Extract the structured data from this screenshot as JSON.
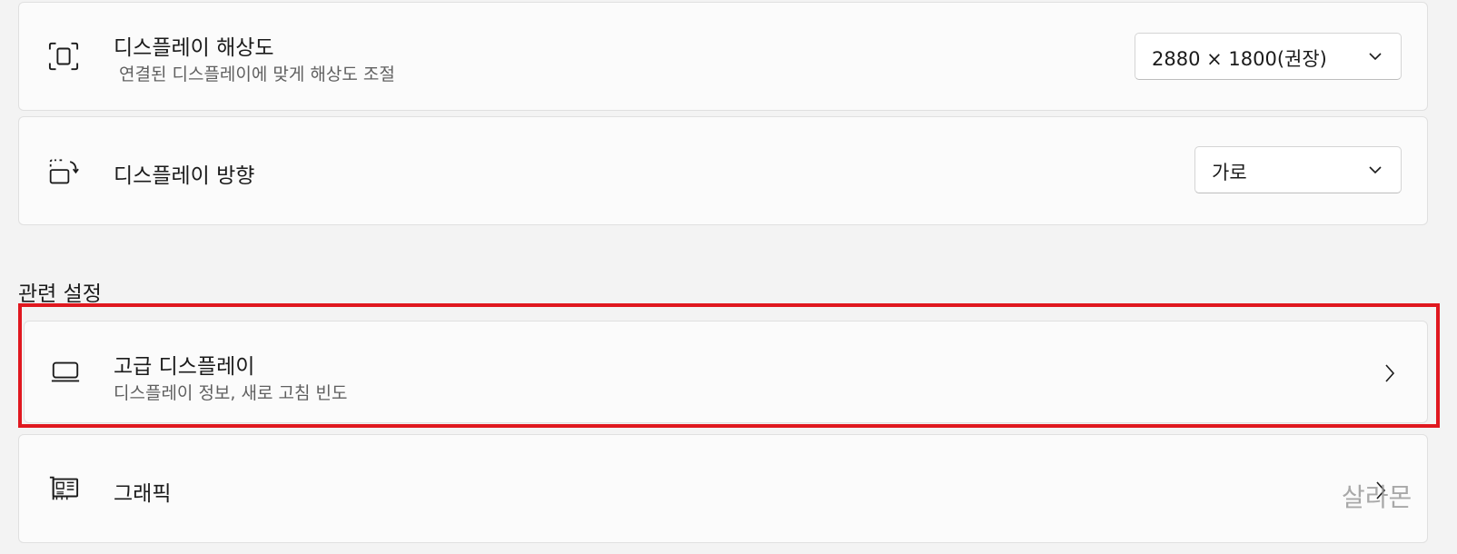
{
  "display_resolution": {
    "title": "디스플레이 해상도",
    "subtitle": "연결된 디스플레이에 맞게 해상도 조절",
    "value": "2880 × 1800(권장)",
    "icon": "resolution-icon"
  },
  "display_orientation": {
    "title": "디스플레이 방향",
    "value": "가로",
    "icon": "orientation-icon"
  },
  "related_settings": {
    "heading": "관련 설정",
    "advanced_display": {
      "title": "고급 디스플레이",
      "subtitle": "디스플레이 정보, 새로 고침 빈도",
      "icon": "laptop-icon"
    },
    "graphics": {
      "title": "그래픽",
      "icon": "graphics-card-icon"
    }
  },
  "watermark": "살라몬",
  "colors": {
    "highlight": "#e0181f",
    "background": "#f3f3f3",
    "card": "#fbfbfb"
  }
}
